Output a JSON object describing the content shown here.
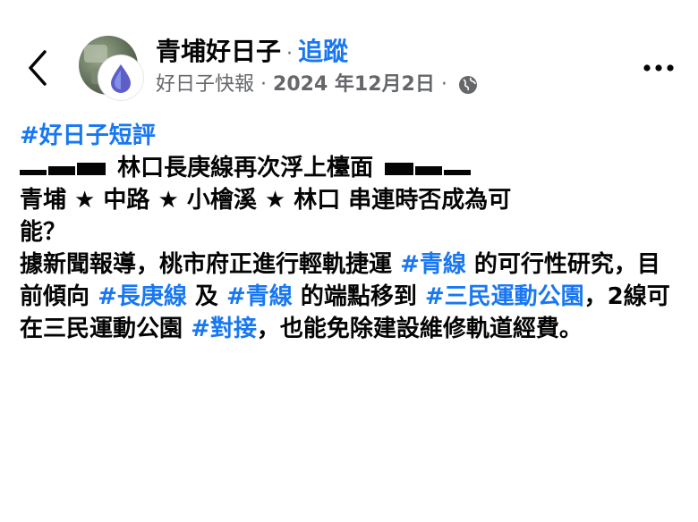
{
  "header": {
    "page_name": "青埔好日子",
    "separator": "·",
    "follow_label": "追蹤",
    "author": "好日子快報",
    "meta_sep1": "·",
    "date": "2024 年12月2日",
    "meta_sep2": "·"
  },
  "post": {
    "hashtag_top": "#好日子短評",
    "headline": "林口長庚線再次浮上檯面",
    "route_line1": "青埔 ★ 中路 ★ 小檜溪 ★ 林口 串連時否成為可",
    "route_line2": "能？",
    "body": {
      "t1": "據新聞報導，桃市府正進行輕軌捷運 ",
      "h1": "#青線",
      "t2": " 的可行性研究，目前傾向 ",
      "h2": "#長庚線",
      "t3": " 及 ",
      "h3": "#青線",
      "t4": " 的端點移到 ",
      "h4": "#三民運動公園",
      "t5": "，2線可在三民運動公園 ",
      "h5": "#對接",
      "t6": "，也能免除建設維修軌道經費。"
    }
  },
  "colors": {
    "accent": "#1877f2",
    "text": "#050505",
    "secondary": "#65676b"
  },
  "icons": {
    "back": "chevron-left-icon",
    "privacy": "globe-icon",
    "more": "more-horizontal-icon"
  }
}
